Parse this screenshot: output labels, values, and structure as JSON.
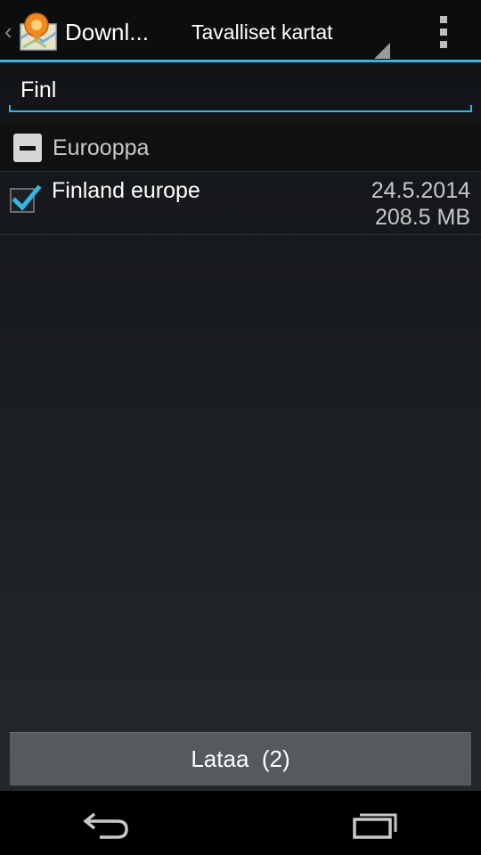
{
  "action_bar": {
    "app_title": "Downl...",
    "spinner_label": "Tavalliset kartat"
  },
  "search": {
    "value": "Finl"
  },
  "group": {
    "label": "Eurooppa",
    "state": "partial"
  },
  "items": [
    {
      "name": "Finland europe",
      "date": "24.5.2014",
      "size": "208.5 MB",
      "checked": true
    }
  ],
  "download_button": {
    "label": "Lataa  (2)"
  },
  "colors": {
    "accent": "#33b5e5",
    "button": "#555a5e"
  },
  "icons": {
    "up": "chevron-left-icon",
    "app": "osmand-map-icon",
    "overflow": "overflow-menu-icon",
    "check": "checkmark-icon",
    "back": "nav-back-icon",
    "recents": "nav-recents-icon"
  }
}
